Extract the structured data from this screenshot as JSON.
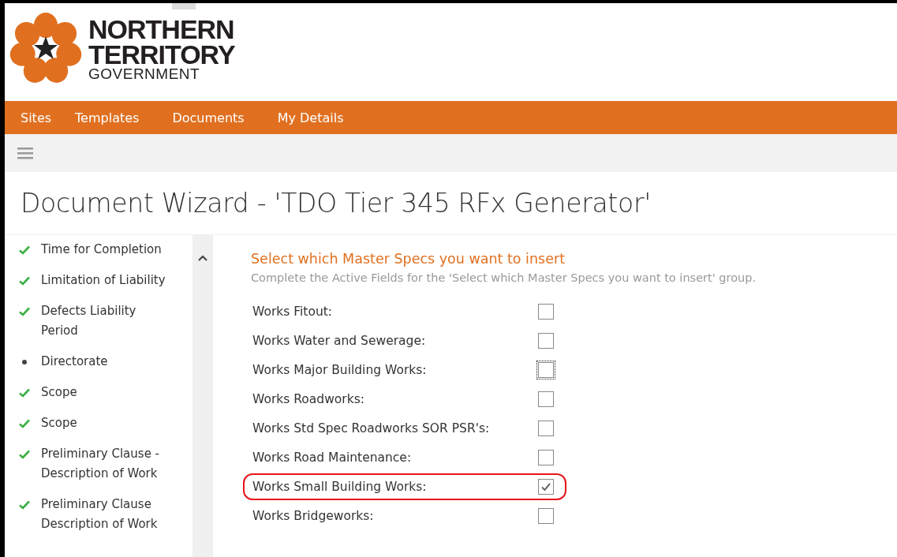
{
  "logo": {
    "lines": [
      "NORTHERN",
      "TERRITORY",
      "GOVERNMENT"
    ]
  },
  "nav": {
    "items": [
      "Sites",
      "Templates",
      "Documents",
      "My Details"
    ]
  },
  "page_title": "Document Wizard - 'TDO Tier 345 RFx Generator'",
  "sidebar": {
    "items": [
      {
        "label": "Time for Completion",
        "completed": true
      },
      {
        "label": "Limitation of Liability",
        "completed": true
      },
      {
        "label": "Defects Liability Period",
        "completed": true
      },
      {
        "label": "Directorate",
        "completed": false
      },
      {
        "label": "Scope",
        "completed": true
      },
      {
        "label": "Scope",
        "completed": true
      },
      {
        "label": "Preliminary Clause - Description of Work",
        "completed": true
      },
      {
        "label": "Preliminary Clause Description of Work",
        "completed": true
      }
    ]
  },
  "group": {
    "title": "Select which Master Specs you want to insert",
    "hint": "Complete the Active Fields for the 'Select which Master Specs you want to insert' group.",
    "fields": [
      {
        "label": "Works Fitout:",
        "checked": false,
        "focused": false,
        "highlighted": false
      },
      {
        "label": "Works Water and Sewerage:",
        "checked": false,
        "focused": false,
        "highlighted": false
      },
      {
        "label": "Works Major Building Works:",
        "checked": false,
        "focused": true,
        "highlighted": false
      },
      {
        "label": "Works Roadworks:",
        "checked": false,
        "focused": false,
        "highlighted": false
      },
      {
        "label": "Works Std Spec Roadworks SOR PSR's:",
        "checked": false,
        "focused": false,
        "highlighted": false
      },
      {
        "label": "Works Road Maintenance:",
        "checked": false,
        "focused": false,
        "highlighted": false
      },
      {
        "label": "Works Small Building Works:",
        "checked": true,
        "focused": false,
        "highlighted": true
      },
      {
        "label": "Works Bridgeworks:",
        "checked": false,
        "focused": false,
        "highlighted": false
      }
    ]
  }
}
